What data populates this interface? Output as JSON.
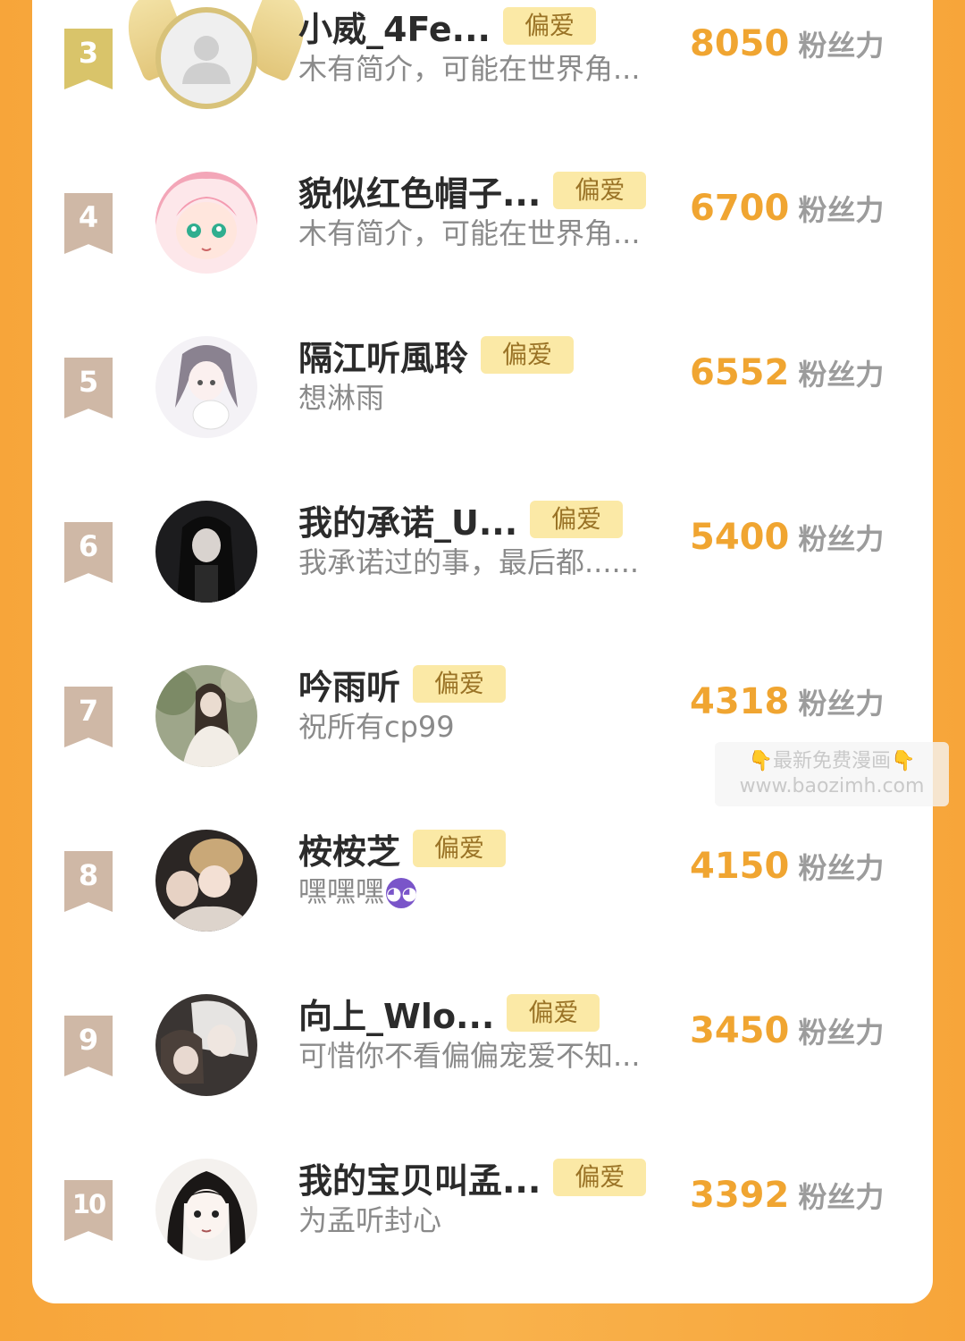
{
  "badge_label": "偏爱",
  "fans_unit": "粉丝力",
  "watermark": {
    "line1": "最新免费漫画",
    "line2": "www.baozimh.com"
  },
  "users": [
    {
      "rank": "3",
      "name": "小威_4Fe...",
      "bio": "木有简介，可能在世界角...",
      "fans": "8050",
      "avatar": "default-avatar-icon"
    },
    {
      "rank": "4",
      "name": "貌似红色帽子...",
      "bio": "木有简介，可能在世界角...",
      "fans": "6700",
      "avatar": "pink-hair-anime-avatar"
    },
    {
      "rank": "5",
      "name": "隔江听風聆",
      "bio": "想淋雨",
      "fans": "6552",
      "avatar": "anime-girl-sketch-avatar"
    },
    {
      "rank": "6",
      "name": "我的承诺_U...",
      "bio": "我承诺过的事，最后都......",
      "fans": "5400",
      "avatar": "dark-hair-girl-avatar"
    },
    {
      "rank": "7",
      "name": "吟雨听",
      "bio": "祝所有cp99",
      "fans": "4318",
      "avatar": "forest-girl-avatar"
    },
    {
      "rank": "8",
      "name": "桉桉芝",
      "bio": "嘿嘿嘿",
      "bio_emoji": "devil-emoji-icon",
      "fans": "4150",
      "avatar": "bear-hat-couple-avatar"
    },
    {
      "rank": "9",
      "name": "向上_Wlo...",
      "bio": "可惜你不看偏偏宠爱不知...",
      "fans": "3450",
      "avatar": "white-hair-couple-avatar"
    },
    {
      "rank": "10",
      "name": "我的宝贝叫孟...",
      "bio": "为孟听封心",
      "fans": "3392",
      "avatar": "black-hair-anime-avatar"
    }
  ],
  "colors": {
    "accent": "#f0a531",
    "badge_bg": "#fbe9a6",
    "rank_ribbon": "#cfb8a6",
    "frame_orange": "#f7a53a"
  }
}
